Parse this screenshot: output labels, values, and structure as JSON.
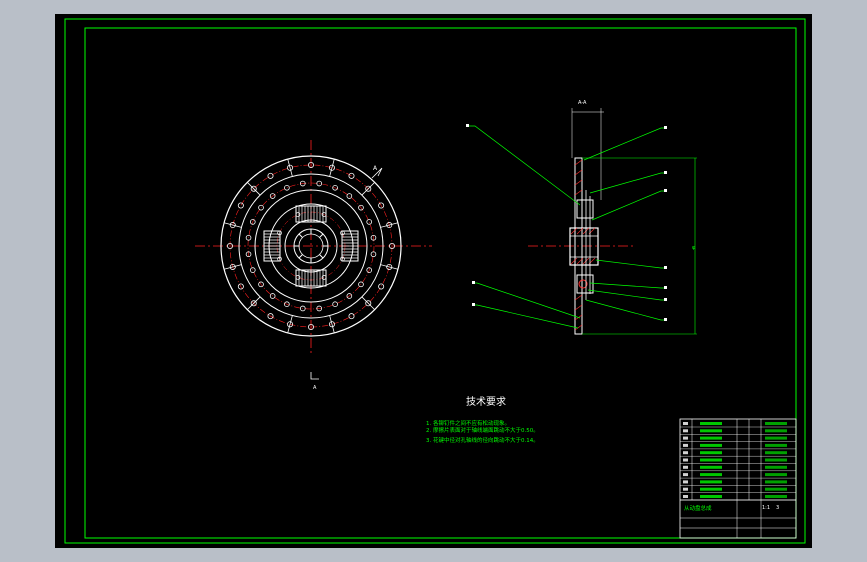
{
  "colors": {
    "background": "#b9bfc8",
    "canvas": "#000000",
    "frame": "#00ff00",
    "disc": "#ffffff",
    "center_line": "#ff2020",
    "hatch": "#ff3030",
    "leader": "#00ff00"
  },
  "section_label": "A-A",
  "view_label_front": "A",
  "view_label_bottom": "A",
  "tech_requirements": {
    "title": "技术要求",
    "items": [
      "1. 各铆钉件之间不应有松动现象。",
      "2. 摩擦片表面对于轴线端面跳动不大于0.50。",
      "3. 花键中径对孔轴线的径向跳动不大于0.14。"
    ]
  },
  "title_block": {
    "drawing_name": "从动盘总成",
    "scale": "1:1",
    "sheet": "3"
  }
}
